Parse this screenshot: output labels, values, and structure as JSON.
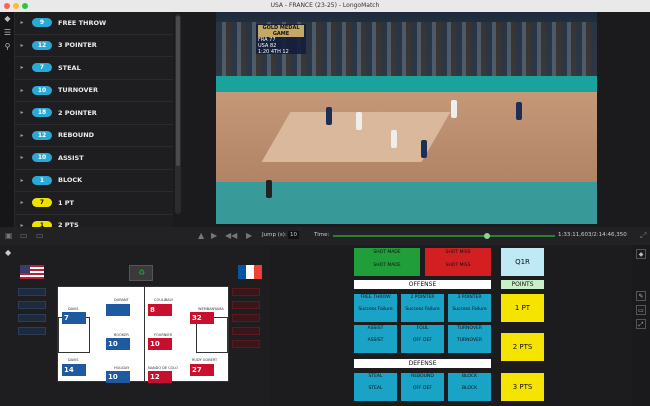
{
  "window": {
    "title": "USA - FRANCE (23-25)  - LongoMatch"
  },
  "events": [
    {
      "count": "9",
      "label": "FREE THROW",
      "color": "blue"
    },
    {
      "count": "12",
      "label": "3 POINTER",
      "color": "blue"
    },
    {
      "count": "7",
      "label": "STEAL",
      "color": "blue"
    },
    {
      "count": "10",
      "label": "TURNOVER",
      "color": "blue"
    },
    {
      "count": "18",
      "label": "2 POINTER",
      "color": "blue"
    },
    {
      "count": "12",
      "label": "REBOUND",
      "color": "blue"
    },
    {
      "count": "10",
      "label": "ASSIST",
      "color": "blue"
    },
    {
      "count": "1",
      "label": "BLOCK",
      "color": "blue"
    },
    {
      "count": "7",
      "label": "1 PT",
      "color": "yellow"
    },
    {
      "count": "1",
      "label": "2 PTS",
      "color": "yellow"
    }
  ],
  "video": {
    "score_header": "GOLD MEDAL GAME",
    "team1": "FRA",
    "score1": "77",
    "team2": "USA",
    "score2": "82",
    "clock": "1:20",
    "quarter": "4TH",
    "shot": "12"
  },
  "controls": {
    "jump_label": "Jump (s):",
    "jump_value": "10",
    "time_label": "Time:",
    "time_value": "1:33:11,603/2:14:46,350"
  },
  "court": {
    "home": [
      {
        "number": "",
        "name": "DURANT"
      },
      {
        "number": "7",
        "name": "DAVIS"
      },
      {
        "number": "10",
        "name": "BOOKER"
      },
      {
        "number": "14",
        "name": "DAVIS"
      },
      {
        "number": "10",
        "name": "HOLIDAY"
      },
      {
        "number": "12",
        "name": "EDWARDS"
      },
      {
        "number": "",
        "name": "DAVIS"
      }
    ],
    "away": [
      {
        "number": "8",
        "name": "COULIBALY"
      },
      {
        "number": "32",
        "name": "WEMBANYAMA"
      },
      {
        "number": "10",
        "name": "FOURNIER"
      },
      {
        "number": "12",
        "name": "NANDO DE COLO"
      },
      {
        "number": "27",
        "name": "RUDY GOBERT"
      }
    ]
  },
  "tagging": {
    "shot_made": {
      "title": "SHOT MADE",
      "sub": "SHOT MADE"
    },
    "shot_miss": {
      "title": "SHOT MISS",
      "sub": "SHOT MISS"
    },
    "qtr": "Q1R",
    "offense": "OFFENSE",
    "points": "POINTS",
    "free_throw": {
      "title": "FREE THROW",
      "a": "Success",
      "b": "Failure"
    },
    "two_pointer": {
      "title": "2 POINTER",
      "a": "Success",
      "b": "Failure"
    },
    "three_pointer": {
      "title": "3 POINTER",
      "a": "Success",
      "b": "Failure"
    },
    "assist": {
      "title": "ASSIST",
      "sub": "ASSIST"
    },
    "foul": {
      "title": "FOUL",
      "a": "OFF",
      "b": "DEF"
    },
    "turnover": {
      "title": "TURNOVER",
      "sub": "TURNOVER"
    },
    "defense": "DEFENSE",
    "steal": {
      "title": "STEAL",
      "sub": "STEAL"
    },
    "rebound": {
      "title": "REBOUND",
      "a": "OFF",
      "b": "DEF"
    },
    "block": {
      "title": "BLOCK",
      "sub": "BLOCK"
    },
    "one_pt": "1 PT",
    "two_pts": "2 PTS",
    "three_pts": "3 PTS"
  },
  "colors": {
    "accent_blue": "#19a3c7",
    "accent_yellow": "#f5e400",
    "shot_made": "#1f9e3a",
    "shot_miss": "#d41f22"
  }
}
